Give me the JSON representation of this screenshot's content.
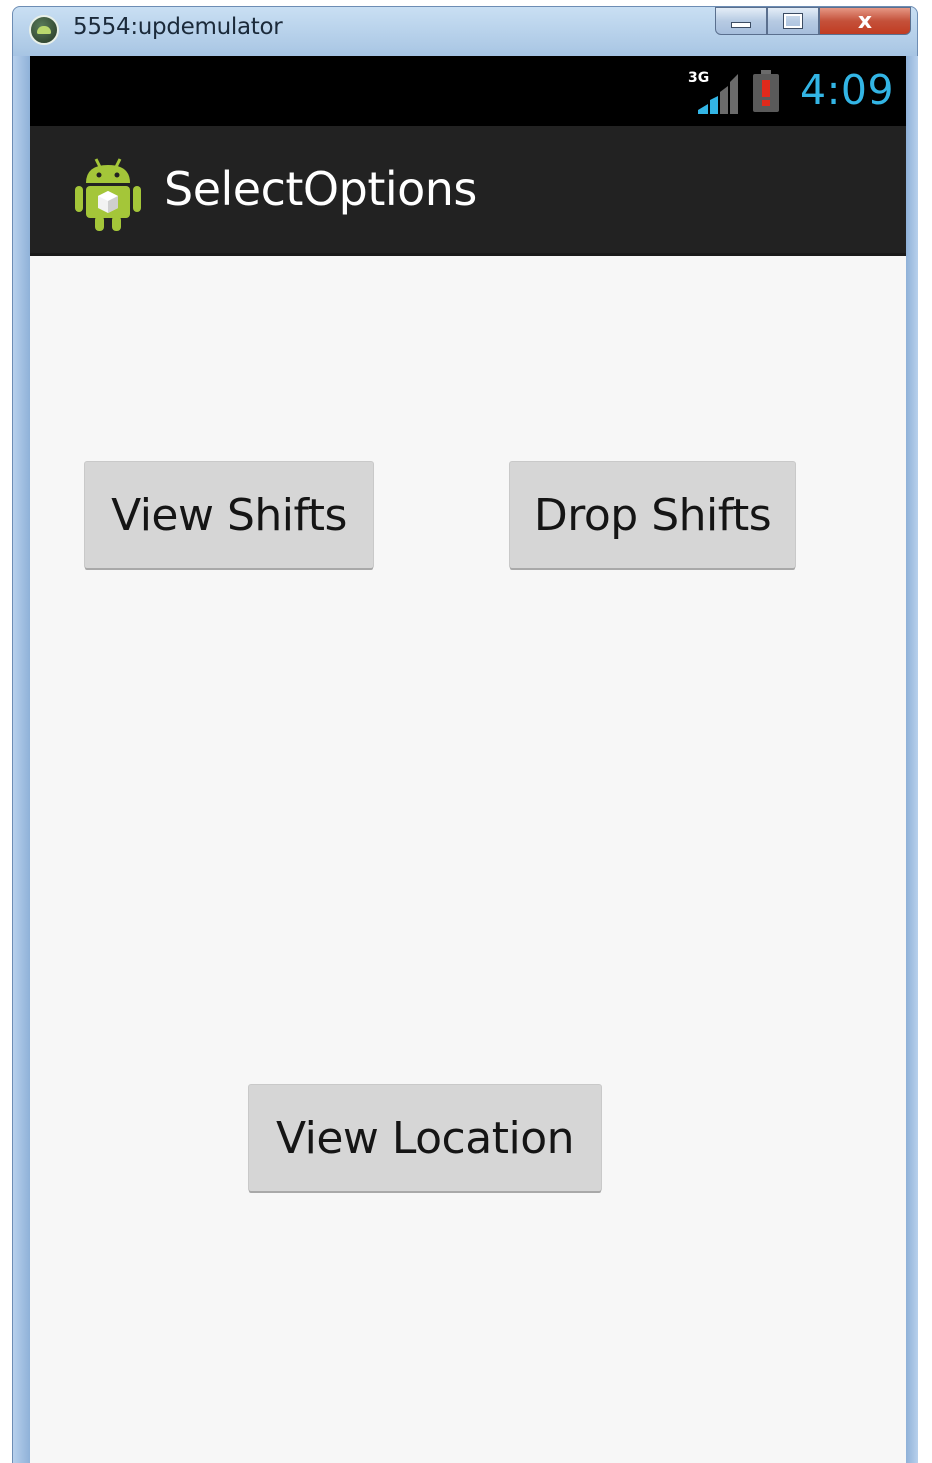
{
  "window": {
    "title": "5554:updemulator",
    "minimize_icon": "minimize-icon",
    "maximize_icon": "maximize-icon",
    "close_glyph": "x",
    "close_icon": "close-icon"
  },
  "statusbar": {
    "network": "3G",
    "signal_icon": "signal-strength-icon",
    "battery_icon": "battery-low-icon",
    "time": "4:09",
    "time_color": "#33b5e5"
  },
  "actionbar": {
    "icon": "android-launcher-icon",
    "title": "SelectOptions"
  },
  "buttons": {
    "view_shifts": "View Shifts",
    "drop_shifts": "Drop Shifts",
    "view_location": "View Location"
  },
  "colors": {
    "actionbar_bg": "#222222",
    "statusbar_bg": "#000000",
    "content_bg": "#f7f7f7",
    "button_bg": "#d6d6d6",
    "android_green": "#a4c639"
  }
}
